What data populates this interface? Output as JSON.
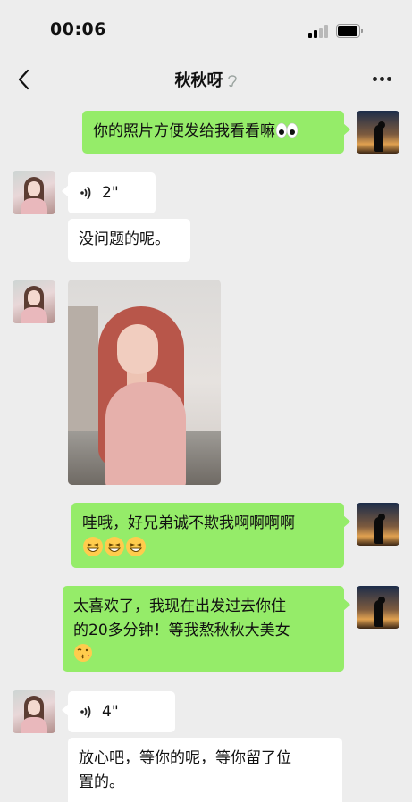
{
  "status_bar": {
    "time": "00:06"
  },
  "nav": {
    "title": "秋秋呀"
  },
  "messages": [
    {
      "side": "right",
      "type": "text",
      "text": "你的照片方便发给我看看嘛",
      "trailing_emoji": "eyes-emoji"
    },
    {
      "side": "left",
      "type": "voice",
      "duration": "2\""
    },
    {
      "side": "left",
      "type": "text",
      "text": "没问题的呢。"
    },
    {
      "side": "left",
      "type": "image",
      "description": "photo"
    },
    {
      "side": "right",
      "type": "text",
      "line1": "哇哦，好兄弟诚不欺我啊啊啊啊",
      "emoji": "grinning-squinting-emoji x3"
    },
    {
      "side": "right",
      "type": "text",
      "line1": "太喜欢了，我现在出发过去你住",
      "line2": "的20多分钟！等我熬秋秋大美女",
      "emoji": "kissing-emoji"
    },
    {
      "side": "left",
      "type": "voice",
      "duration": "4\""
    },
    {
      "side": "left",
      "type": "text",
      "line1": "放心吧，等你的呢，等你留了位",
      "line2": "置的。"
    }
  ],
  "colors": {
    "background": "#ededed",
    "sent_bubble": "#95ec69",
    "received_bubble": "#ffffff"
  }
}
